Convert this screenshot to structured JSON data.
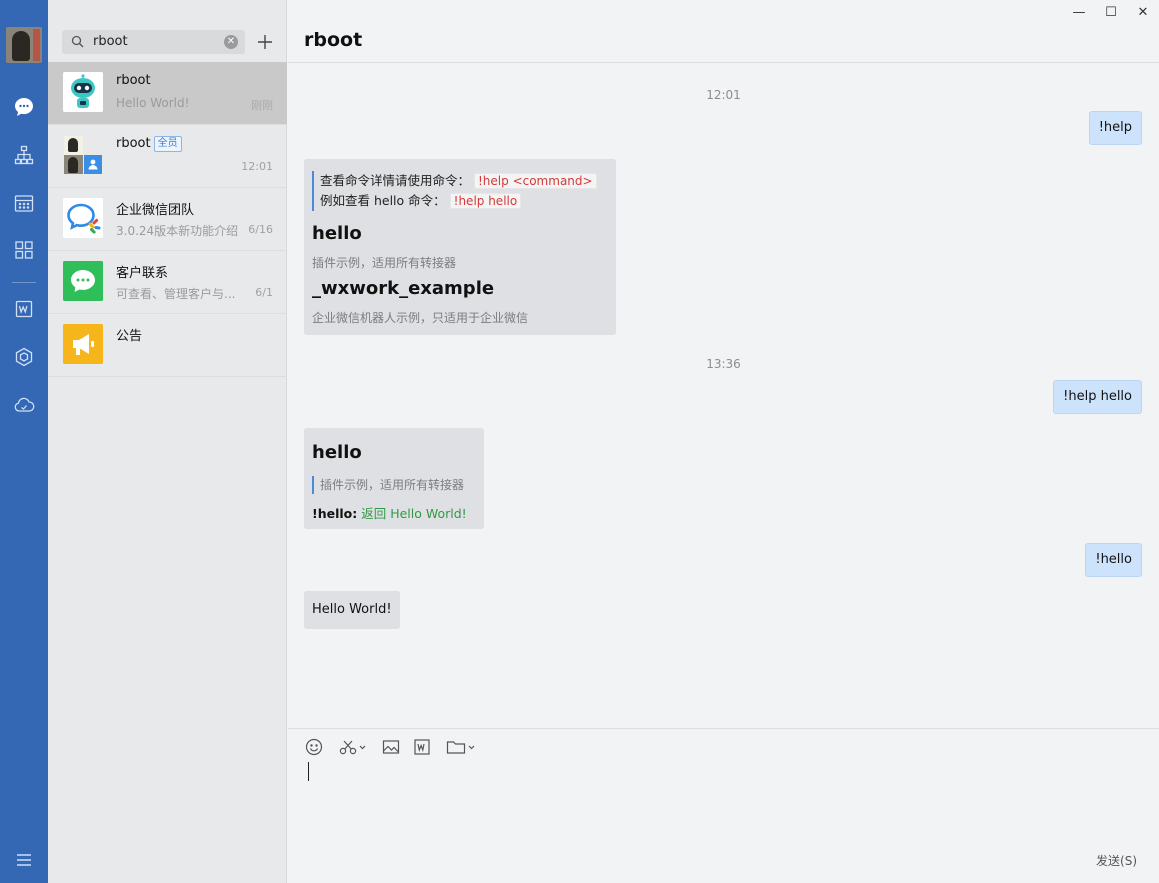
{
  "sidebar": {
    "icons": [
      "chat-icon",
      "org-chart-icon",
      "calendar-icon",
      "apps-grid-icon",
      "document-icon",
      "cube-icon",
      "cloud-icon",
      "menu-icon"
    ]
  },
  "search": {
    "value": "rboot",
    "clear_glyph": "✕"
  },
  "conversations": [
    {
      "name": "rboot",
      "preview": "Hello World!",
      "time": "刚刚",
      "active": true
    },
    {
      "name": "rboot",
      "tag": "全员",
      "preview": "",
      "time": "12:01"
    },
    {
      "name": "企业微信团队",
      "preview": "3.0.24版本新功能介绍",
      "time": "6/16"
    },
    {
      "name": "客户联系",
      "preview": "可查看、管理客户与...",
      "time": "6/1"
    },
    {
      "name": "公告",
      "preview": "",
      "time": ""
    }
  ],
  "chat": {
    "title": "rboot",
    "window_controls": [
      "—",
      "☐",
      "✕"
    ],
    "messages": {
      "ts1": "12:01",
      "m1": "!help",
      "card1": {
        "line1_prefix": "查看命令详情请使用命令：",
        "line1_code": "!help <command>",
        "line2_prefix": "例如查看 hello 命令：",
        "line2_code": "!help hello",
        "item1_title": "hello",
        "item1_desc": "插件示例，适用所有转接器",
        "item2_title": "_wxwork_example",
        "item2_desc": "企业微信机器人示例，只适用于企业微信"
      },
      "ts2": "13:36",
      "m2": "!help hello",
      "card2": {
        "title": "hello",
        "desc": "插件示例，适用所有转接器",
        "cmd": "!hello",
        "sep": ":",
        "ret": "返回 Hello World!"
      },
      "m3": "!hello",
      "m4": "Hello World!"
    },
    "toolbar": [
      "emoji-icon",
      "scissors-icon",
      "image-icon",
      "word-file-icon",
      "folder-icon"
    ],
    "send_label": "发送(S)"
  },
  "colors": {
    "nav": "#3468b4",
    "bubble_self": "#cde3fb",
    "bubble_other": "#dfe0e3",
    "code_red": "#d23b3b",
    "green": "#2d9b45"
  }
}
